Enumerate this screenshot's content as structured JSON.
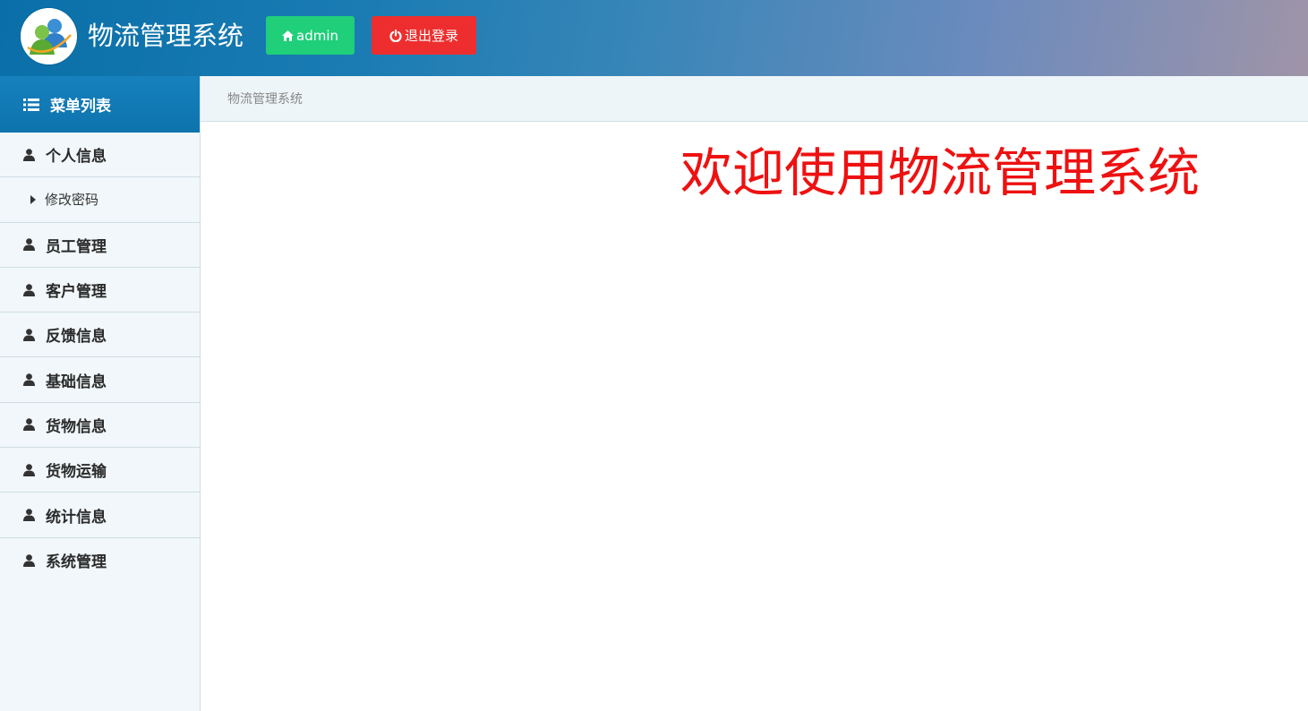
{
  "header": {
    "app_title": "物流管理系统",
    "user_button_label": "admin",
    "logout_button_label": "退出登录",
    "user_button_color": "#1fcf7a",
    "logout_button_color": "#ee2e2e"
  },
  "sidebar": {
    "title": "菜单列表",
    "items": [
      {
        "label": "个人信息",
        "icon": "user-icon"
      },
      {
        "label": "修改密码",
        "icon": "caret-right-icon",
        "sub": true
      },
      {
        "label": "员工管理",
        "icon": "user-icon"
      },
      {
        "label": "客户管理",
        "icon": "user-icon"
      },
      {
        "label": "反馈信息",
        "icon": "user-icon"
      },
      {
        "label": "基础信息",
        "icon": "user-icon"
      },
      {
        "label": "货物信息",
        "icon": "user-icon"
      },
      {
        "label": "货物运输",
        "icon": "user-icon"
      },
      {
        "label": "统计信息",
        "icon": "user-icon"
      },
      {
        "label": "系统管理",
        "icon": "user-icon"
      }
    ]
  },
  "breadcrumb": {
    "text": "物流管理系统"
  },
  "main": {
    "welcome_text": "欢迎使用物流管理系统",
    "welcome_color": "#ee1111"
  }
}
